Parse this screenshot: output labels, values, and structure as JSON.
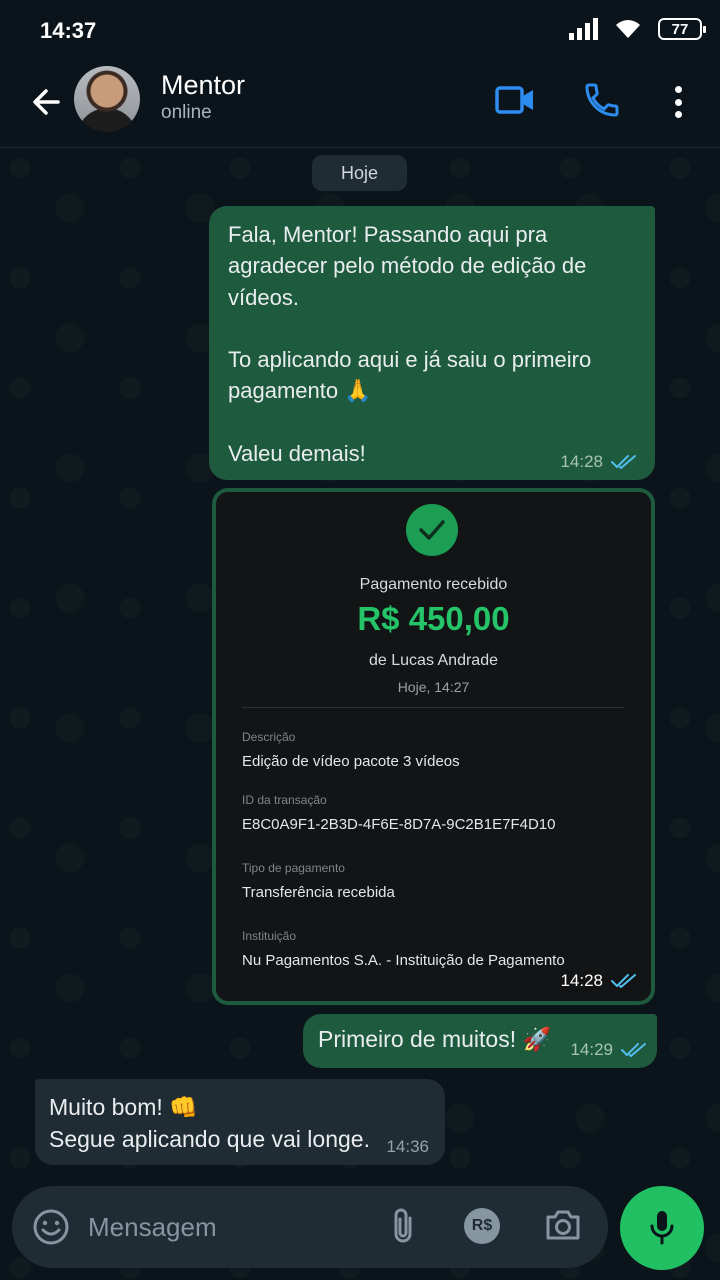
{
  "status_bar": {
    "time": "14:37",
    "battery": "77"
  },
  "header": {
    "contact_name": "Mentor",
    "contact_status": "online"
  },
  "date_chip": "Hoje",
  "messages": [
    {
      "text": "Fala, Mentor! Passando aqui pra agradecer pelo método de edição de vídeos.\n\nTo aplicando aqui e já saiu o primeiro pagamento 🙏\n\nValeu demais!",
      "time": "14:28"
    },
    {
      "receipt": {
        "title": "Pagamento recebido",
        "amount": "R$ 450,00",
        "from": "de Lucas Andrade",
        "date": "Hoje, 14:27",
        "fields": [
          {
            "label": "Descrição",
            "value": "Edição de vídeo pacote 3 vídeos"
          },
          {
            "label": "ID da transação",
            "value": "E8C0A9F1-2B3D-4F6E-8D7A-9C2B1E7F4D10"
          },
          {
            "label": "Tipo de pagamento",
            "value": "Transferência recebida"
          },
          {
            "label": "Instituição",
            "value": "Nu Pagamentos S.A. - Instituição de Pagamento"
          }
        ]
      },
      "time": "14:28"
    },
    {
      "text": "Primeiro de muitos! 🚀",
      "time": "14:29"
    },
    {
      "text": "Muito bom! 👊\nSegue aplicando que vai longe.",
      "time": "14:36"
    }
  ],
  "input": {
    "placeholder": "Mensagem",
    "pix_label": "R$"
  },
  "colors": {
    "accent": "#21c063",
    "outgoing_bubble": "#1e5a3e",
    "incoming_bubble": "#202c33",
    "read_ticks": "#53bdeb"
  }
}
